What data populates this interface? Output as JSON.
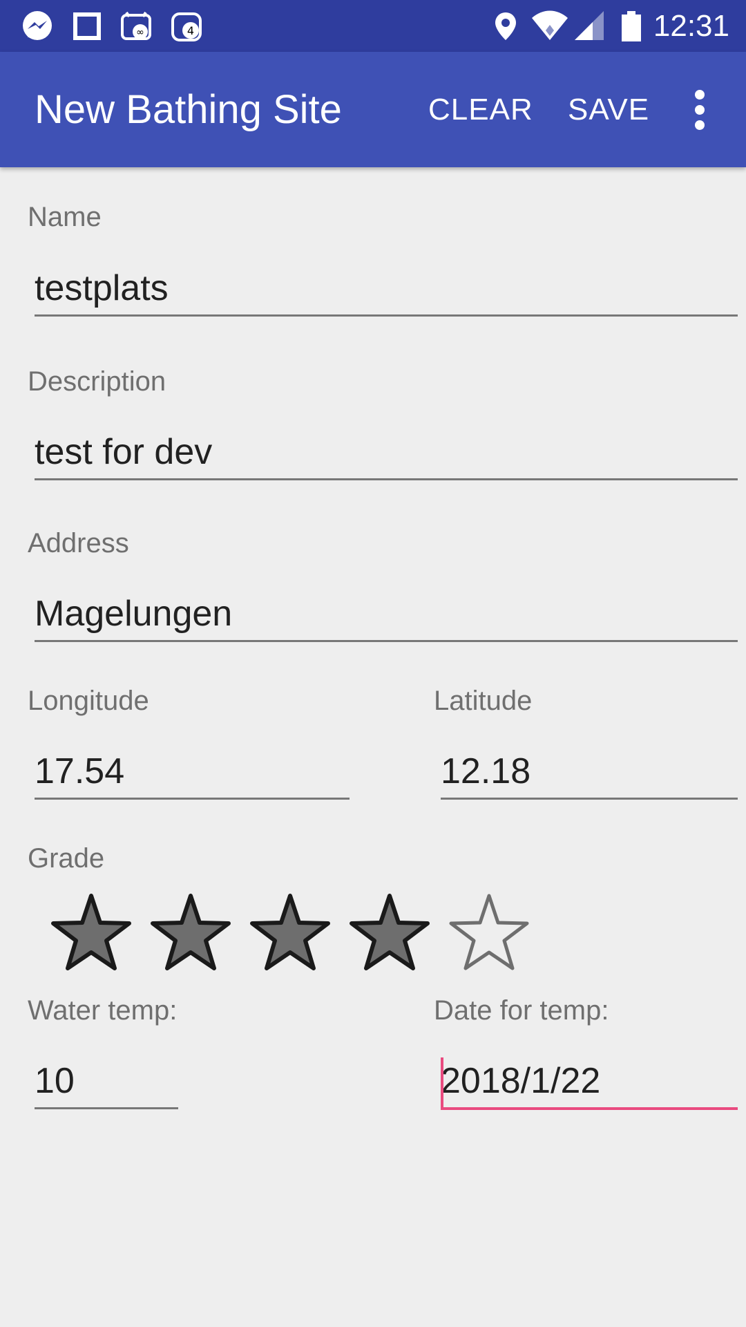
{
  "status_bar": {
    "time": "12:31",
    "icons": [
      "messenger-icon",
      "square-icon",
      "nfc-chat-icon",
      "camera-badge-icon",
      "location-icon",
      "wifi-icon",
      "signal-icon",
      "battery-icon"
    ],
    "camera_badge": "4",
    "chat_badge": "∞"
  },
  "app_bar": {
    "title": "New Bathing Site",
    "clear_label": "CLEAR",
    "save_label": "SAVE",
    "overflow_icon": "more-vert-icon",
    "color": "#3f51b5"
  },
  "form": {
    "name": {
      "label": "Name",
      "value": "testplats"
    },
    "description": {
      "label": "Description",
      "value": "test for dev"
    },
    "address": {
      "label": "Address",
      "value": "Magelungen"
    },
    "longitude": {
      "label": "Longitude",
      "value": "17.54"
    },
    "latitude": {
      "label": "Latitude",
      "value": "12.18"
    },
    "grade": {
      "label": "Grade",
      "rating": 4,
      "max": 5
    },
    "water_temp": {
      "label": "Water temp:",
      "value": "10"
    },
    "date_for_temp": {
      "label": "Date for temp:",
      "value": "2018/1/22"
    }
  },
  "colors": {
    "status_bar": "#2f3d9e",
    "accent": "#e94a7f",
    "star_filled": "#6e6e6e",
    "star_outline": "#1a1a1a"
  }
}
